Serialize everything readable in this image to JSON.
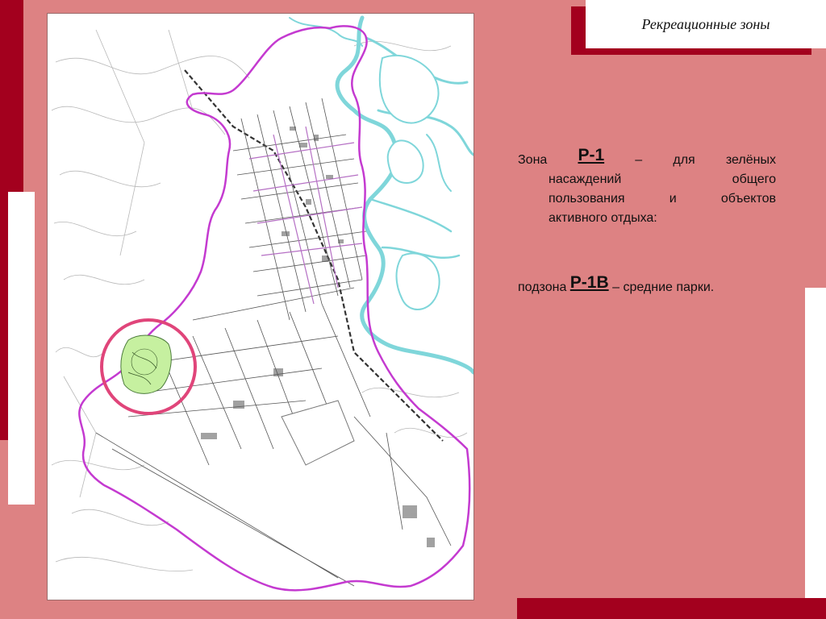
{
  "slide": {
    "title": "Рекреационные зоны",
    "colors": {
      "background": "#dd8283",
      "accent_dark": "#a3001e",
      "panel": "#ffffff",
      "boundary": "#c43ad0",
      "water": "#7fd6da",
      "park": "#c6f0a0",
      "highlight_ring": "#e0457a"
    }
  },
  "zone": {
    "prefix": "Зона",
    "code": "Р-1",
    "dash": "–",
    "word_for": "для",
    "word_green": "зелёных",
    "line2_a": "насаждений",
    "line2_b": "общего",
    "line3": "пользования и объектов",
    "line4": "активного отдыха:"
  },
  "subzone": {
    "prefix": "подзона",
    "code": "Р-1В",
    "suffix": "– средние парки."
  },
  "map": {
    "highlighted_zone": "Р-1В"
  }
}
